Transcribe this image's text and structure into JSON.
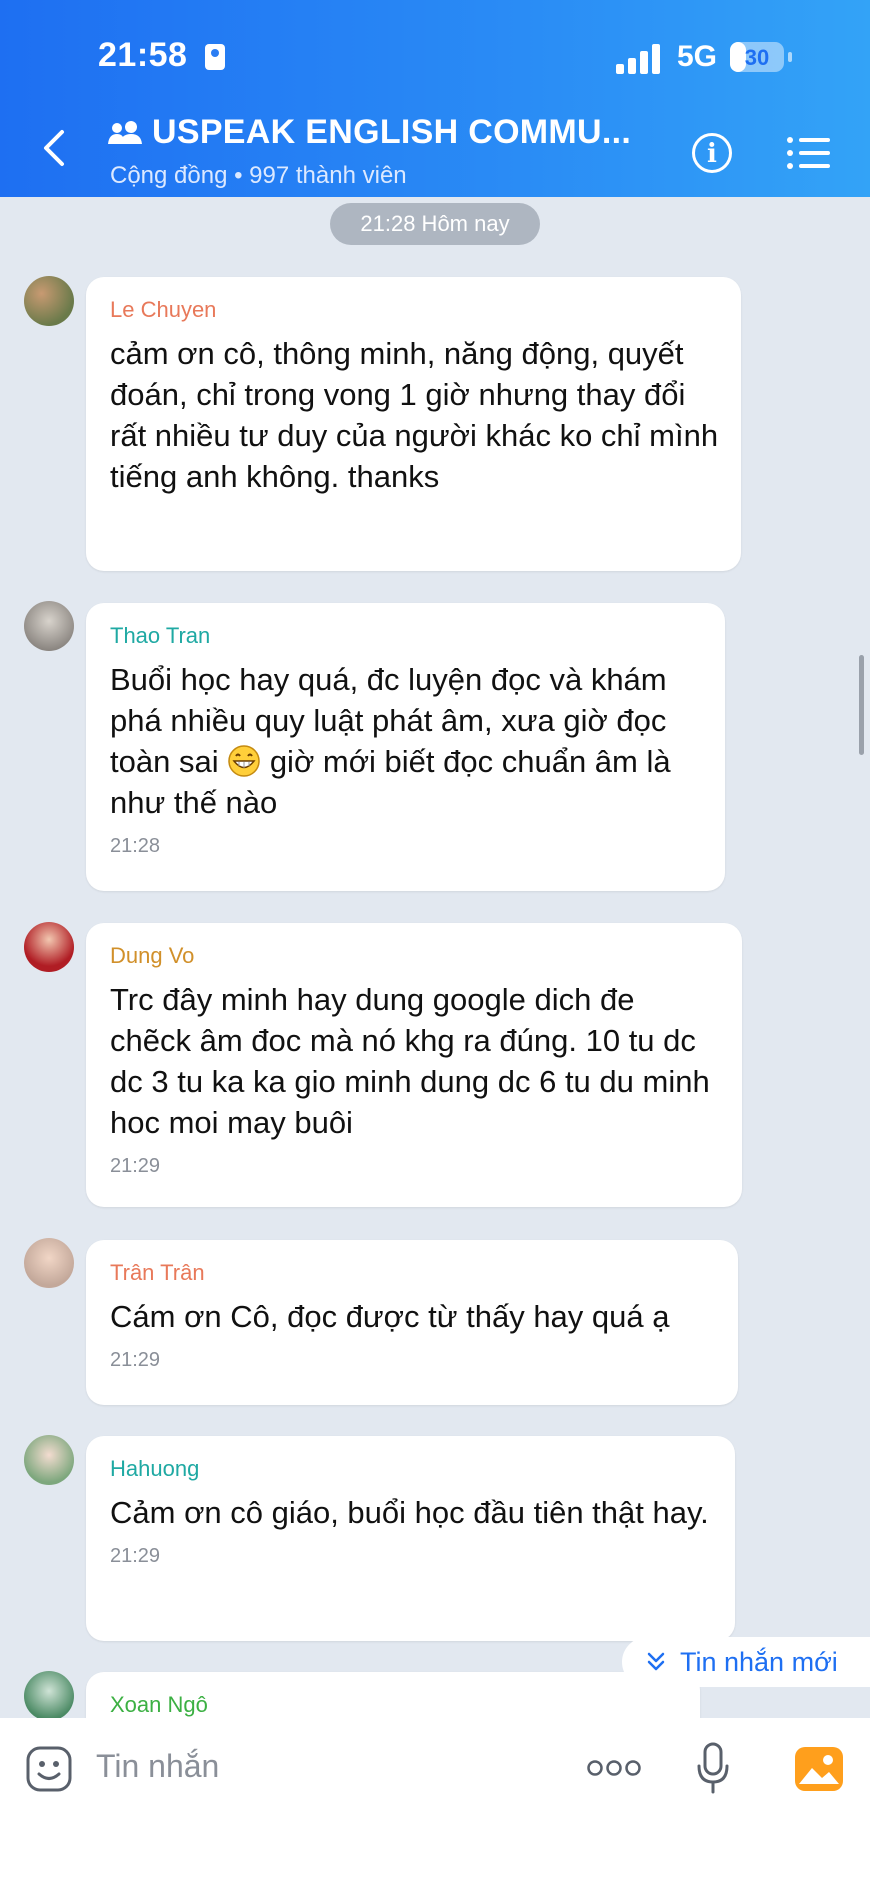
{
  "status_bar": {
    "time": "21:58",
    "network": "5G",
    "battery": "30",
    "battery_level": 0.3
  },
  "header": {
    "title": "USPEAK ENGLISH COMMU...",
    "subtitle": "Cộng đồng • 997 thành viên",
    "icons": {
      "back": "back-chevron-icon",
      "group": "group-icon",
      "info": "info-icon",
      "menu": "menu-list-icon"
    }
  },
  "chat": {
    "time_divider": "21:28 Hôm nay",
    "messages": [
      {
        "sender": "Le Chuyen",
        "sender_color": "#e8795a",
        "text": "cảm ơn cô, thông minh, năng động, quyết đoán, chỉ trong vong 1 giờ nhưng thay đổi rất nhiều tư duy của người khác ko chỉ mình tiếng anh không. thanks",
        "time": ""
      },
      {
        "sender": "Thao Tran",
        "sender_color": "#1fa9a3",
        "text_before": "Buổi học hay quá, đc luyện đọc và khám phá nhiều quy luật phát âm, xưa giờ đọc toàn sai",
        "text_after": " giờ mới biết đọc chuẩn âm là như thế nào",
        "emoji": "grinning-face-emoji",
        "time": "21:28"
      },
      {
        "sender": "Dung Vo",
        "sender_color": "#d1902a",
        "text": "Trc đây minh hay dung google dich đe chẽck âm đoc mà nó khg ra đúng. 10 tu dc dc 3 tu ka ka gio minh dung dc 6 tu du minh hoc moi may buôi",
        "time": "21:29"
      },
      {
        "sender": "Trân Trân",
        "sender_color": "#e8795a",
        "text": "Cám ơn Cô, đọc được từ thấy hay quá ạ",
        "time": "21:29"
      },
      {
        "sender": "Hahuong",
        "sender_color": "#1fa9a3",
        "text": "Cảm ơn cô giáo, buổi học đầu tiên thật hay.",
        "time": "21:29"
      },
      {
        "sender": "Xoan Ngô",
        "sender_color": "#3cb043",
        "text": "",
        "time": ""
      }
    ],
    "new_messages_label": "Tin nhắn mới"
  },
  "input_bar": {
    "placeholder": "Tin nhắn",
    "icons": {
      "emoji": "emoji-sticker-icon",
      "more": "more-dots-icon",
      "mic": "microphone-icon",
      "image": "image-gallery-icon"
    }
  }
}
